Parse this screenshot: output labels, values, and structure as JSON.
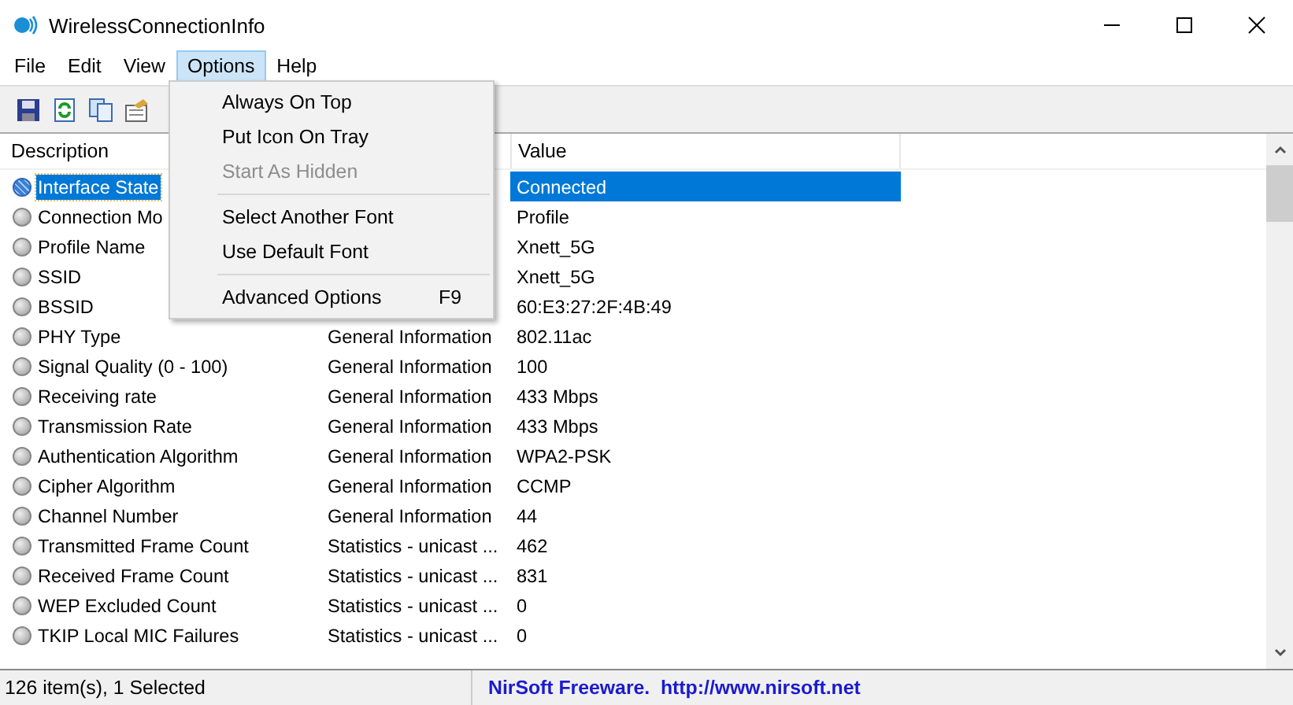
{
  "window": {
    "title": "WirelessConnectionInfo"
  },
  "menu_bar": [
    {
      "label": "File",
      "selected": false
    },
    {
      "label": "Edit",
      "selected": false
    },
    {
      "label": "View",
      "selected": false
    },
    {
      "label": "Options",
      "selected": true
    },
    {
      "label": "Help",
      "selected": false
    }
  ],
  "options_menu": [
    {
      "kind": "item",
      "label": "Always On Top",
      "disabled": false
    },
    {
      "kind": "item",
      "label": "Put Icon On Tray",
      "disabled": false
    },
    {
      "kind": "item",
      "label": "Start As Hidden",
      "disabled": true
    },
    {
      "kind": "separator"
    },
    {
      "kind": "item",
      "label": "Select Another Font",
      "disabled": false
    },
    {
      "kind": "item",
      "label": "Use Default Font",
      "disabled": false
    },
    {
      "kind": "separator"
    },
    {
      "kind": "item",
      "label": "Advanced Options",
      "shortcut": "F9",
      "disabled": false
    }
  ],
  "table": {
    "columns": [
      "Description",
      "Value"
    ],
    "rows": [
      {
        "description": "Interface State",
        "value": "Connected",
        "selected": true
      },
      {
        "description": "Connection Mo",
        "value": "Profile",
        "selected": false
      },
      {
        "description": "Profile Name",
        "value": "Xnett_5G",
        "selected": false
      },
      {
        "description": "SSID",
        "value": "Xnett_5G",
        "selected": false
      },
      {
        "description": "BSSID",
        "value": "60:E3:27:2F:4B:49",
        "selected": false
      },
      {
        "description": "PHY Type",
        "category": "General Information",
        "value": "802.11ac",
        "selected": false
      },
      {
        "description": "Signal Quality (0 - 100)",
        "category": "General Information",
        "value": "100",
        "selected": false
      },
      {
        "description": "Receiving rate",
        "category": "General Information",
        "value": "433 Mbps",
        "selected": false
      },
      {
        "description": "Transmission Rate",
        "category": "General Information",
        "value": "433 Mbps",
        "selected": false
      },
      {
        "description": "Authentication Algorithm",
        "category": "General Information",
        "value": "WPA2-PSK",
        "selected": false
      },
      {
        "description": "Cipher Algorithm",
        "category": "General Information",
        "value": "CCMP",
        "selected": false
      },
      {
        "description": "Channel Number",
        "category": "General Information",
        "value": "44",
        "selected": false
      },
      {
        "description": "Transmitted Frame Count",
        "category": "Statistics - unicast ...",
        "value": "462",
        "selected": false
      },
      {
        "description": "Received Frame Count",
        "category": "Statistics - unicast ...",
        "value": "831",
        "selected": false
      },
      {
        "description": "WEP Excluded Count",
        "category": "Statistics - unicast ...",
        "value": "0",
        "selected": false
      },
      {
        "description": "TKIP Local MIC Failures",
        "category": "Statistics - unicast ...",
        "value": "0",
        "selected": false
      }
    ]
  },
  "status_bar": {
    "count": "126 item(s), 1 Selected",
    "credit": "NirSoft Freeware.  http://www.nirsoft.net"
  }
}
